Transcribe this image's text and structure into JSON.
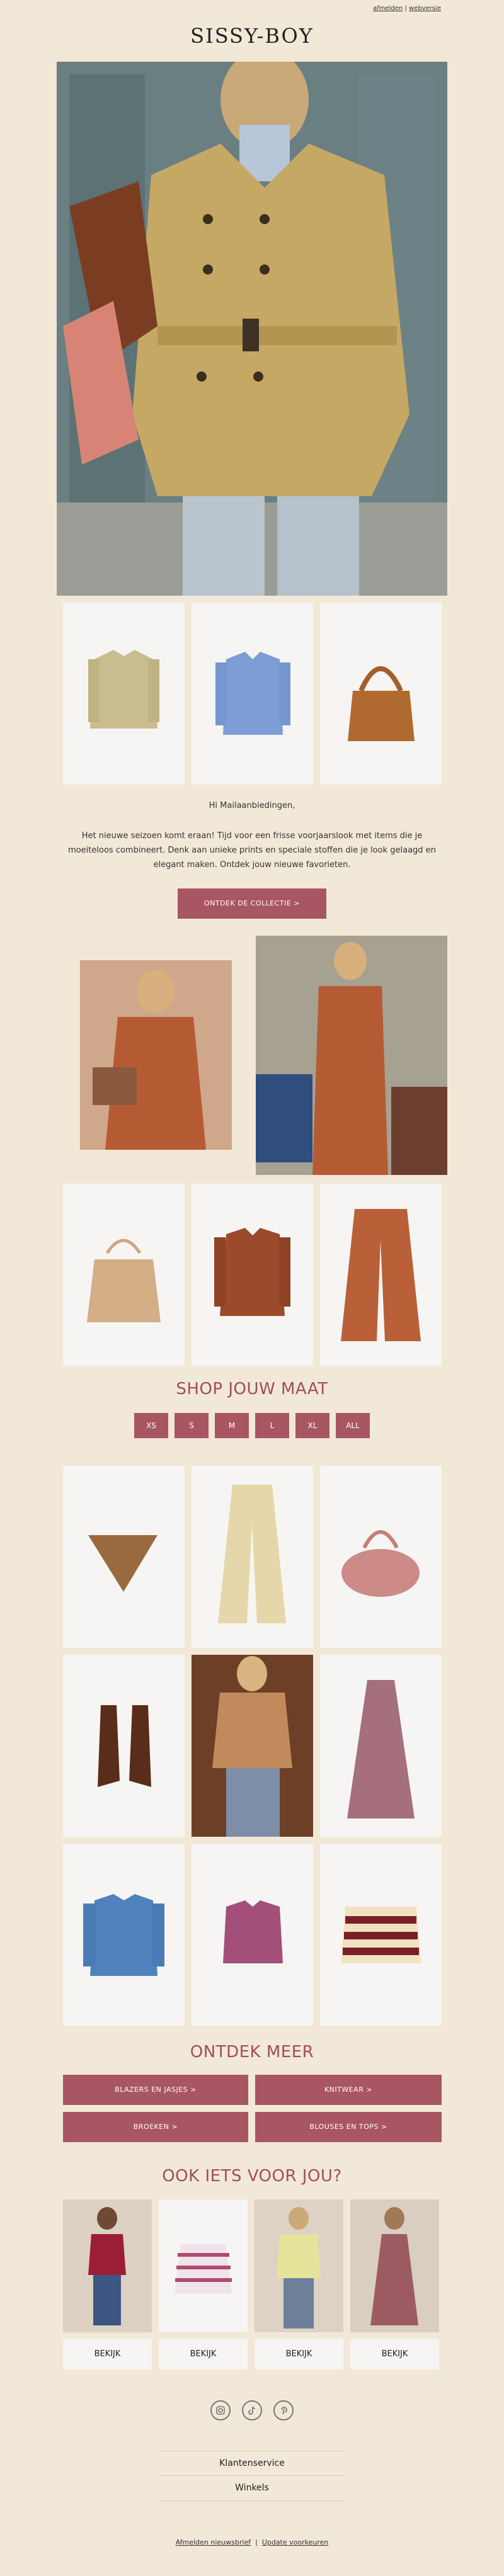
{
  "header": {
    "unsubscribe_link": "afmelden",
    "separator": "|",
    "webversion_link": "webversie",
    "logo_text": "SISSY-BOY"
  },
  "intro": {
    "greeting": "Hi Mailaanbiedingen,",
    "body": "Het nieuwe seizoen komt eraan! Tijd voor een frisse voorjaarslook met items die je moeiteloos combineert. Denk aan unieke prints en speciale stoffen die je look gelaagd en elegant maken. Ontdek jouw nieuwe favorieten.",
    "cta_label": "ONTDEK DE COLLECTIE >"
  },
  "size_section": {
    "title": "SHOP JOUW MAAT",
    "sizes": [
      "XS",
      "S",
      "M",
      "L",
      "XL",
      "ALL"
    ]
  },
  "discover": {
    "title": "ONTDEK MEER",
    "buttons": [
      "BLAZERS EN JASJES >",
      "KNITWEAR >",
      "BROEKEN >",
      "BLOUSES EN TOPS >"
    ]
  },
  "recommend": {
    "title": "OOK IETS VOOR JOU?",
    "button_label": "BEKIJK"
  },
  "social": {
    "icons": [
      "instagram-icon",
      "tiktok-icon",
      "pinterest-icon"
    ]
  },
  "footer": {
    "customer_service": "Klantenservice",
    "stores": "Winkels",
    "unsubscribe_newsletter": "Afmelden nieuwsbrief",
    "update_preferences": "Update voorkeuren"
  },
  "colors": {
    "accent": "#a85663",
    "heading": "#a14d5c",
    "background": "#f2e8d8"
  }
}
